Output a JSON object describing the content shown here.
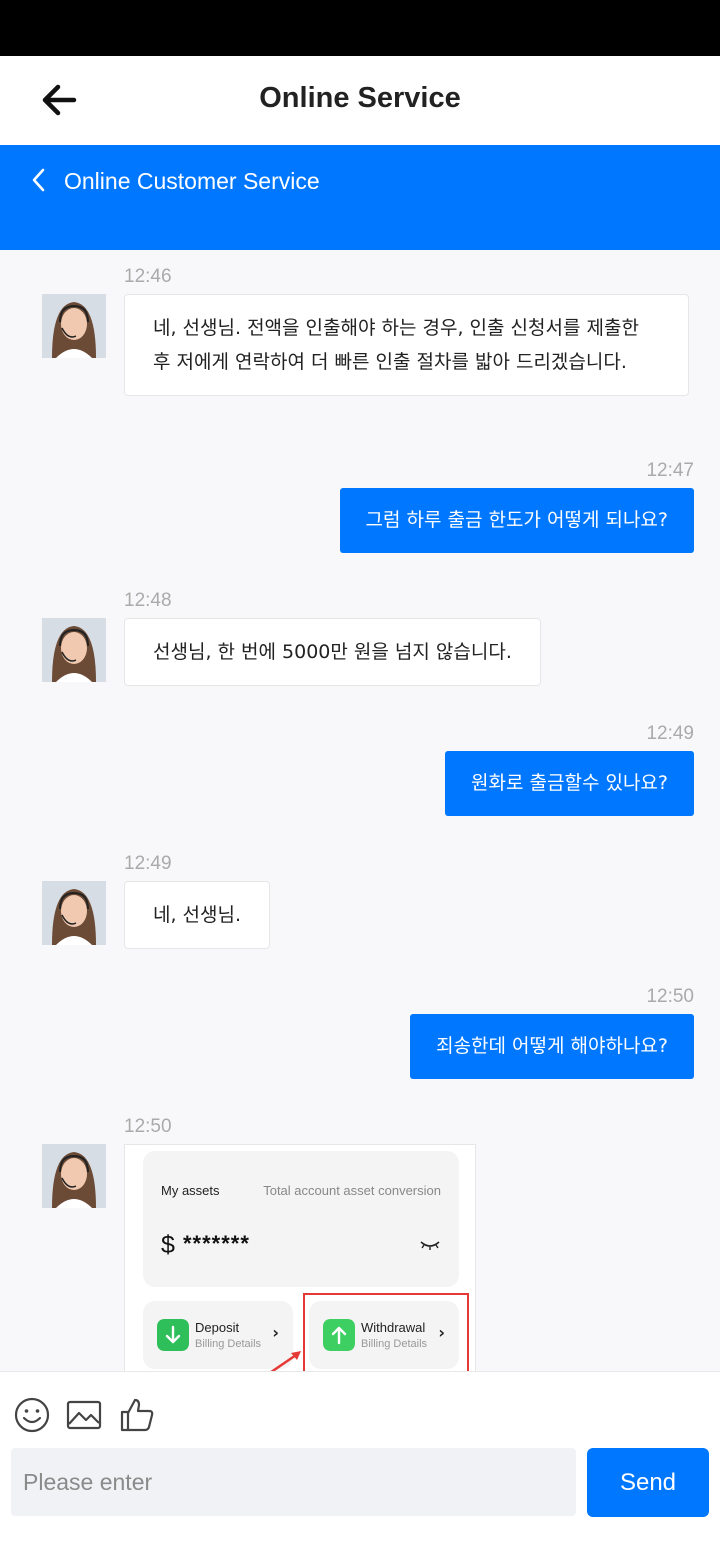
{
  "header": {
    "title": "Online Service"
  },
  "service_bar": {
    "label": "Online Customer Service"
  },
  "messages": [
    {
      "time": "12:46",
      "text": "네, 선생님. 전액을 인출해야 하는 경우, 인출 신청서를 제출한 후 저에게 연락하여 더 빠른 인출 절차를 밟아 드리겠습니다."
    },
    {
      "time": "12:47",
      "text": "그럼 하루 출금 한도가 어떻게 되나요?"
    },
    {
      "time": "12:48",
      "text": "선생님, 한 번에 5000만 원을 넘지 않습니다."
    },
    {
      "time": "12:49",
      "text": "원화로 출금할수 있나요?"
    },
    {
      "time": "12:49",
      "text": "네, 선생님."
    },
    {
      "time": "12:50",
      "text": "죄송한데 어떻게 해야하나요?"
    },
    {
      "time": "12:50"
    }
  ],
  "screenshot_card": {
    "assets_label": "My assets",
    "conversion_label": "Total account asset conversion",
    "currency": "$",
    "masked_balance": "*******",
    "deposit": {
      "title": "Deposit",
      "subtitle": "Billing Details"
    },
    "withdrawal": {
      "title": "Withdrawal",
      "subtitle": "Billing Details"
    },
    "chevron": "›"
  },
  "composer": {
    "placeholder": "Please enter",
    "send_label": "Send"
  },
  "colors": {
    "primary": "#0077ff",
    "highlight": "#e53935"
  }
}
